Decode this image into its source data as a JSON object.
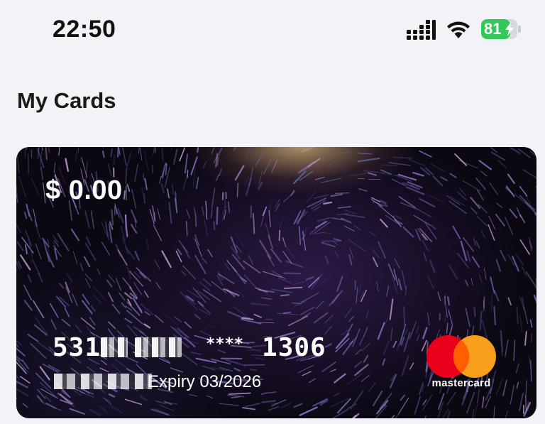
{
  "status_bar": {
    "time": "22:50",
    "battery_level": "81",
    "battery_fraction": 0.81,
    "signal_icon": "cellular-signal-icon",
    "wifi_icon": "wifi-icon",
    "charging_icon": "bolt-icon"
  },
  "page": {
    "title": "My Cards"
  },
  "card": {
    "balance": "$ 0.00",
    "number_prefix": "531",
    "number_masked_middle": "****",
    "number_last4": "1306",
    "expiry": "Expiry 03/2026",
    "network": "mastercard",
    "colors": {
      "mastercard_red": "#eb001b",
      "mastercard_orange": "#f79e1b",
      "mastercard_overlap": "#ff5f00",
      "battery_green": "#34c759"
    }
  }
}
